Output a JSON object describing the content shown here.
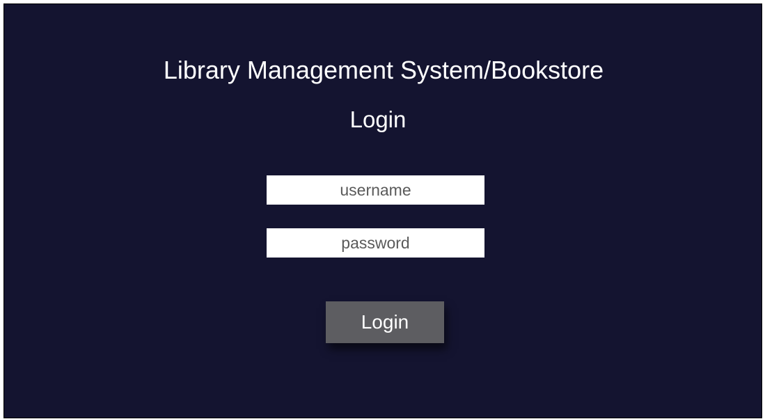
{
  "header": {
    "app_title": "Library Management System/Bookstore",
    "page_heading": "Login"
  },
  "form": {
    "username": {
      "placeholder": "username",
      "value": ""
    },
    "password": {
      "placeholder": "password",
      "value": ""
    },
    "submit_label": "Login"
  },
  "colors": {
    "background": "#141430",
    "text": "#ffffff",
    "field_background": "#ffffff",
    "field_text": "#5a5a5a",
    "button_background": "#5d5d61"
  }
}
